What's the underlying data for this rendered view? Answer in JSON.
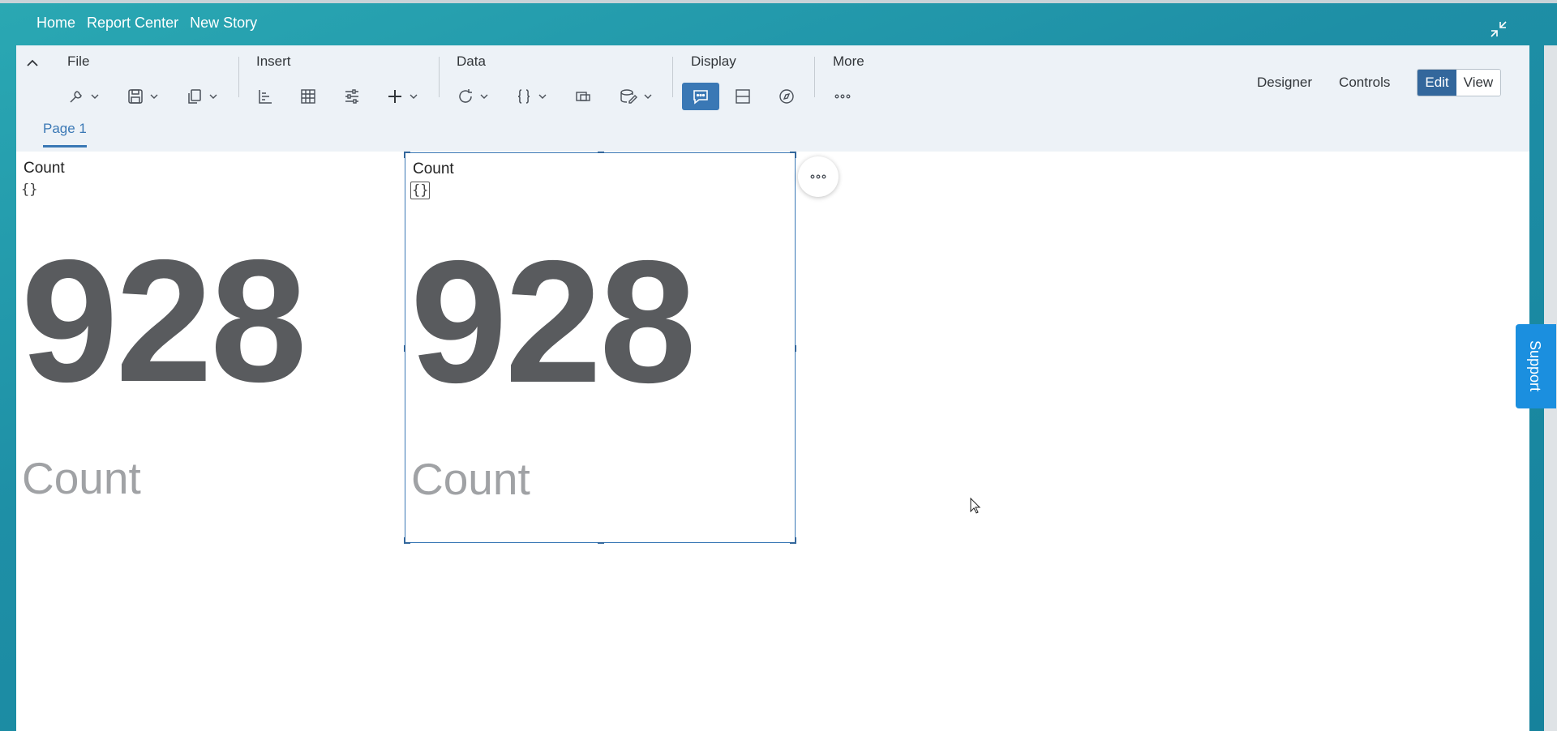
{
  "breadcrumb": [
    "Home",
    "Report Center",
    "New Story"
  ],
  "toolbar": {
    "groups": {
      "file": "File",
      "insert": "Insert",
      "data": "Data",
      "display": "Display",
      "more": "More"
    },
    "designer": "Designer",
    "controls": "Controls",
    "edit": "Edit",
    "view": "View"
  },
  "pages": [
    {
      "label": "Page 1"
    }
  ],
  "tiles": [
    {
      "title": "Count",
      "brace": "{}",
      "value": "928",
      "subtitle": "Count"
    },
    {
      "title": "Count",
      "brace": "{}",
      "value": "928",
      "subtitle": "Count"
    }
  ],
  "support_label": "Support",
  "colors": {
    "accent": "#3a78b5",
    "shell": "#2aa8b3",
    "support": "#1b8fdf"
  }
}
